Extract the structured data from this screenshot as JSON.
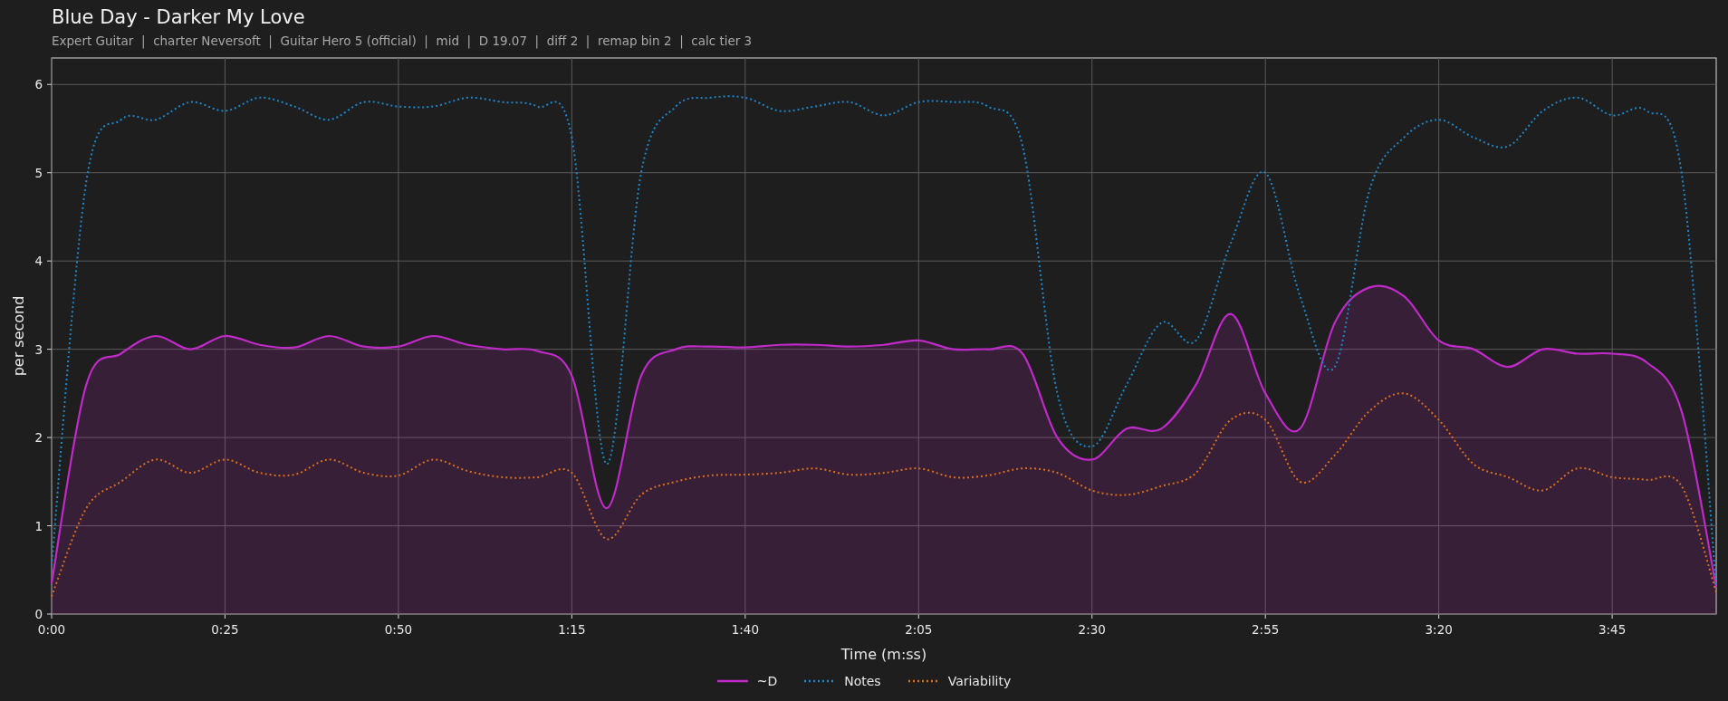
{
  "title": "Blue Day - Darker My Love",
  "subtitle": "Expert Guitar  |  charter Neversoft  |  Guitar Hero 5 (official)  |  mid  |  D 19.07  |  diff 2  |  remap bin 2  |  calc tier 3",
  "chart": {
    "chart_data": {
      "type": "line",
      "xlabel": "Time (m:ss)",
      "ylabel": "per second",
      "x": [
        0,
        5,
        10,
        15,
        20,
        25,
        30,
        35,
        40,
        45,
        50,
        55,
        60,
        65,
        70,
        75,
        80,
        85,
        90,
        95,
        100,
        105,
        110,
        115,
        120,
        125,
        130,
        135,
        140,
        145,
        150,
        155,
        160,
        165,
        170,
        175,
        180,
        185,
        190,
        195,
        200,
        205,
        210,
        215,
        220,
        225,
        230,
        235,
        240
      ],
      "series": [
        {
          "name": "~D",
          "color": "#c02ac8",
          "line_style": "solid",
          "values": [
            0.35,
            2.6,
            2.95,
            3.15,
            3.0,
            3.15,
            3.05,
            3.02,
            3.15,
            3.03,
            3.03,
            3.15,
            3.05,
            3.0,
            2.98,
            2.7,
            1.2,
            2.7,
            3.0,
            3.03,
            3.02,
            3.05,
            3.05,
            3.03,
            3.05,
            3.1,
            3.0,
            3.0,
            2.95,
            2.0,
            1.75,
            2.1,
            2.1,
            2.6,
            3.4,
            2.5,
            2.1,
            3.3,
            3.7,
            3.6,
            3.1,
            3.0,
            2.8,
            3.0,
            2.95,
            2.95,
            2.85,
            2.3,
            0.3
          ]
        },
        {
          "name": "Notes",
          "color": "#1f86c8",
          "line_style": "dotted",
          "values": [
            0.55,
            4.9,
            5.6,
            5.6,
            5.8,
            5.7,
            5.85,
            5.75,
            5.6,
            5.8,
            5.75,
            5.75,
            5.85,
            5.8,
            5.75,
            5.4,
            1.7,
            5.0,
            5.75,
            5.85,
            5.85,
            5.7,
            5.75,
            5.8,
            5.65,
            5.8,
            5.8,
            5.75,
            5.3,
            2.5,
            1.9,
            2.6,
            3.3,
            3.1,
            4.2,
            5.0,
            3.6,
            2.8,
            4.8,
            5.4,
            5.6,
            5.4,
            5.3,
            5.7,
            5.85,
            5.65,
            5.7,
            5.0,
            0.3
          ]
        },
        {
          "name": "Variability",
          "color": "#dc6e1c",
          "line_style": "dotted",
          "values": [
            0.2,
            1.2,
            1.5,
            1.75,
            1.6,
            1.75,
            1.6,
            1.58,
            1.75,
            1.6,
            1.57,
            1.75,
            1.62,
            1.55,
            1.55,
            1.6,
            0.85,
            1.35,
            1.5,
            1.57,
            1.58,
            1.6,
            1.65,
            1.58,
            1.6,
            1.65,
            1.55,
            1.57,
            1.65,
            1.6,
            1.4,
            1.35,
            1.45,
            1.6,
            2.2,
            2.2,
            1.5,
            1.8,
            2.3,
            2.5,
            2.2,
            1.7,
            1.55,
            1.4,
            1.65,
            1.55,
            1.52,
            1.45,
            0.25
          ]
        }
      ],
      "xlim": [
        0,
        240
      ],
      "ylim": [
        0,
        6.3
      ],
      "xticks": [
        {
          "value": 0,
          "label": "0:00"
        },
        {
          "value": 25,
          "label": "0:25"
        },
        {
          "value": 50,
          "label": "0:50"
        },
        {
          "value": 75,
          "label": "1:15"
        },
        {
          "value": 100,
          "label": "1:40"
        },
        {
          "value": 125,
          "label": "2:05"
        },
        {
          "value": 150,
          "label": "2:30"
        },
        {
          "value": 175,
          "label": "2:55"
        },
        {
          "value": 200,
          "label": "3:20"
        },
        {
          "value": 225,
          "label": "3:45"
        }
      ],
      "yticks": [
        0,
        1,
        2,
        3,
        4,
        5,
        6
      ],
      "grid": true
    }
  }
}
